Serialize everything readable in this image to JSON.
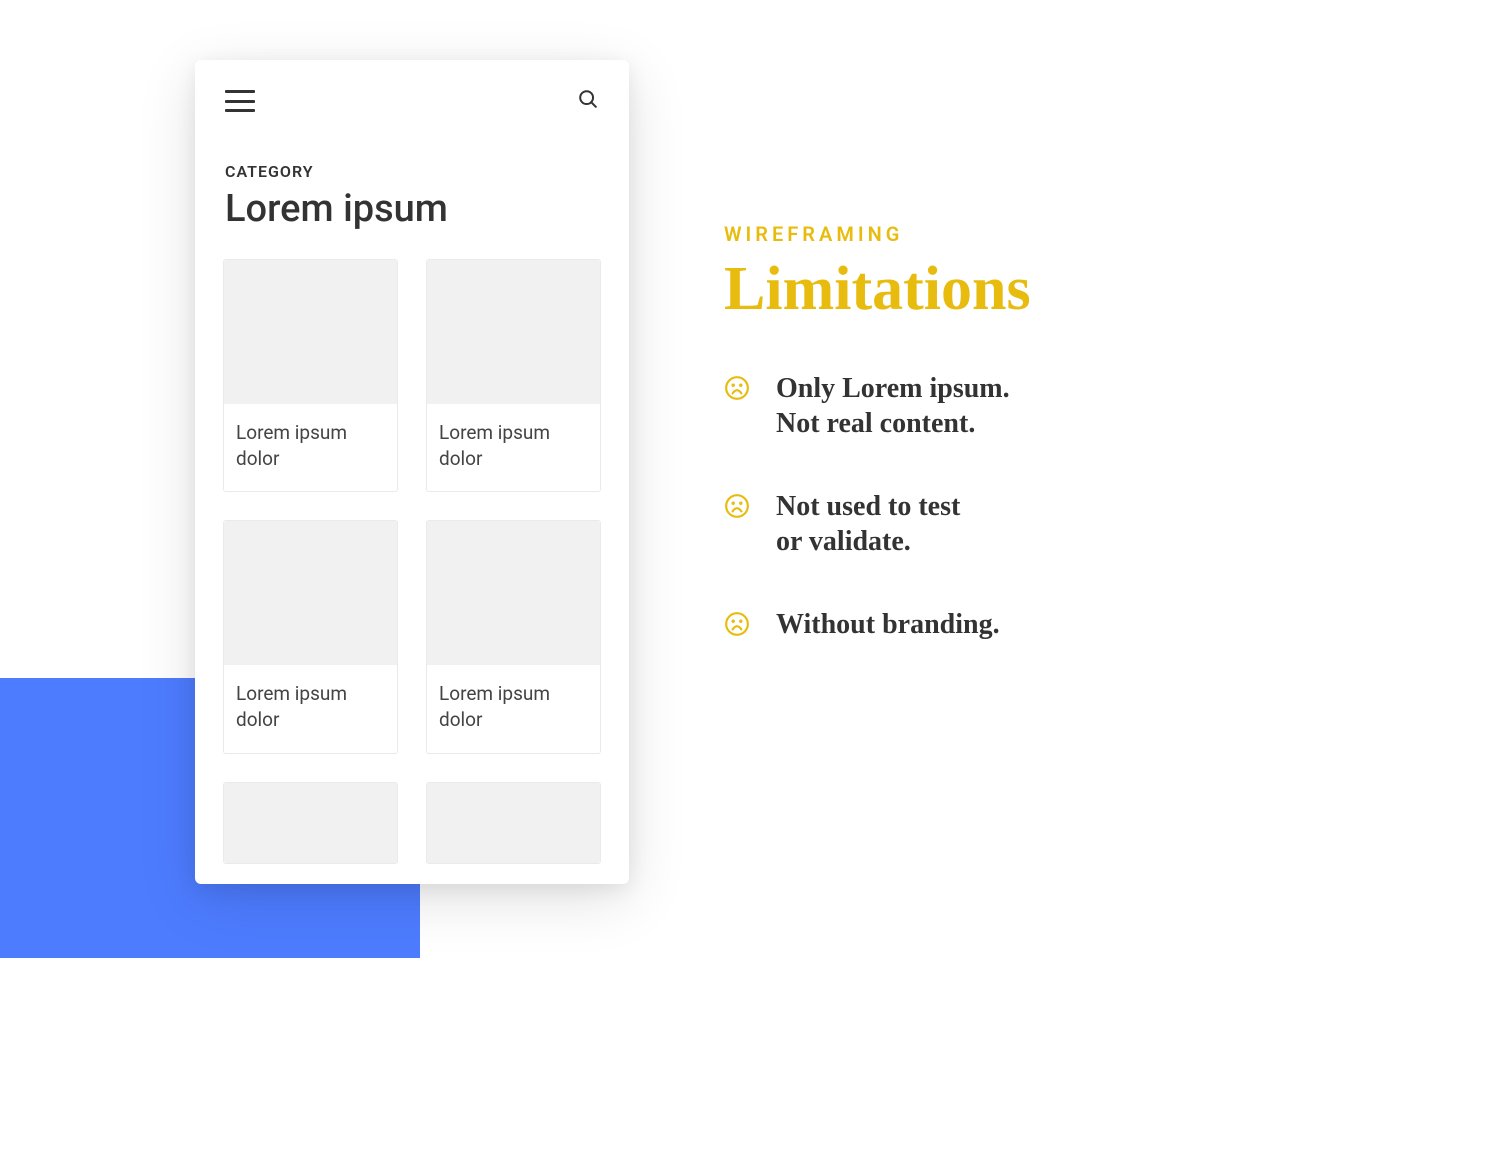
{
  "phone": {
    "category_label": "CATEGORY",
    "title": "Lorem ipsum",
    "cards": [
      {
        "label": "Lorem ipsum dolor"
      },
      {
        "label": "Lorem ipsum dolor"
      },
      {
        "label": "Lorem ipsum dolor"
      },
      {
        "label": "Lorem ipsum dolor"
      },
      {
        "label": ""
      },
      {
        "label": ""
      }
    ]
  },
  "panel": {
    "eyebrow": "WIREFRAMING",
    "heading": "Limitations",
    "bullets": [
      "Only Lorem ipsum.\nNot real content.",
      "Not used to test\nor validate.",
      "Without branding."
    ]
  },
  "colors": {
    "accent_blue": "#4d7cff",
    "accent_gold": "#e8bc0f"
  }
}
